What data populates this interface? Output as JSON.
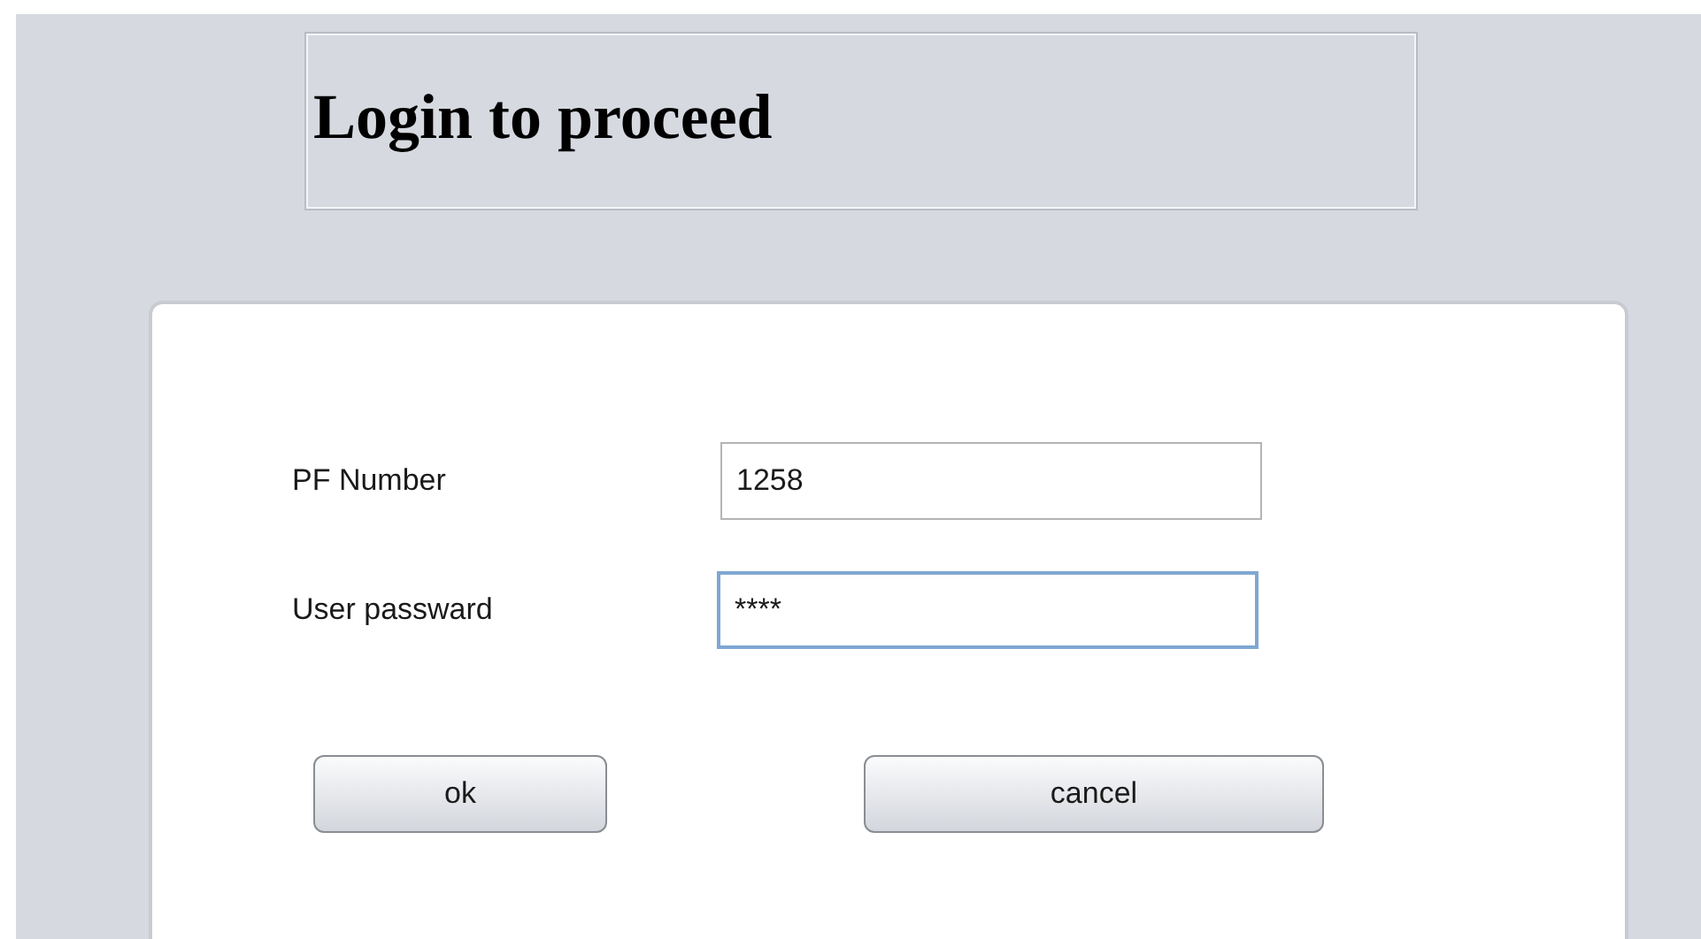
{
  "header": {
    "title": "Login to proceed"
  },
  "fields": [
    {
      "label": "PF Number",
      "value": "1258",
      "focused": false
    },
    {
      "label": "User passward",
      "value": "****",
      "focused": true
    }
  ],
  "buttons": [
    "ok",
    "cancel"
  ]
}
